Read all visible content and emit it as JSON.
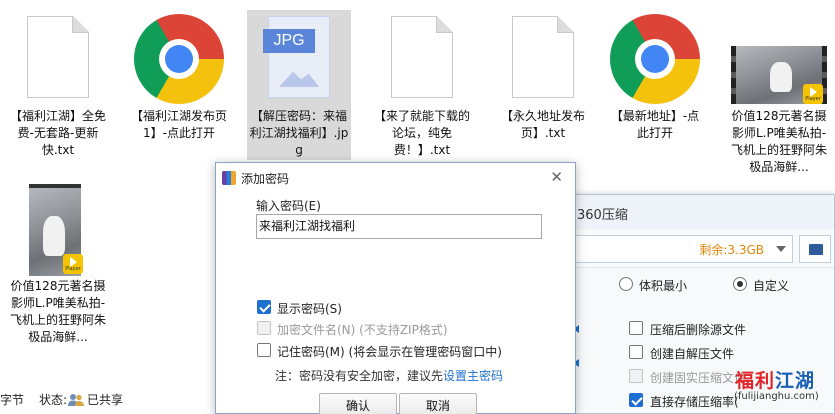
{
  "explorer": {
    "files": [
      {
        "name": "【福利江湖】全免费-无套路-更新快.txt",
        "kind": "txt"
      },
      {
        "name": "【福利江湖发布页1】-点此打开",
        "kind": "chrome"
      },
      {
        "name": "【解压密码：来福利江湖找福利】.jpg",
        "kind": "jpg",
        "icon_text": "JPG"
      },
      {
        "name": "【来了就能下载的论坛，纯免费！】.txt",
        "kind": "txt"
      },
      {
        "name": "【永久地址发布页】.txt",
        "kind": "txt"
      },
      {
        "name": "【最新地址】-点此打开",
        "kind": "chrome"
      },
      {
        "name": "价值128元著名摄影师L.P唯美私拍-飞机上的狂野阿朱 极品海鲜...",
        "kind": "video",
        "badge": "Player"
      },
      {
        "name": "价值128元著名摄影师L.P唯美私拍-飞机上的狂野阿朱 极品海鲜...",
        "kind": "video",
        "badge": "Player"
      }
    ],
    "status": {
      "left": "字节",
      "state_label": "状态:",
      "share_text": "已共享"
    }
  },
  "compressor": {
    "title": "360压缩",
    "remaining": "剩余:3.3GB",
    "radio_options": [
      {
        "label": "体积最小",
        "selected": false
      },
      {
        "label": "自定义",
        "selected": true
      }
    ],
    "checkboxes": [
      {
        "label": "压缩后删除源文件",
        "checked": false,
        "disabled": false
      },
      {
        "label": "创建自解压文件",
        "checked": false,
        "disabled": false
      },
      {
        "label": "创建固实压缩文件",
        "checked": false,
        "disabled": true
      },
      {
        "label": "直接存储压缩率(",
        "checked": true,
        "disabled": false
      }
    ]
  },
  "dialog": {
    "title": "添加密码",
    "close": "✕",
    "input_label": "输入密码(E)",
    "password_value": "来福利江湖找福利",
    "options": [
      {
        "label": "显示密码(S)",
        "checked": true,
        "disabled": false
      },
      {
        "label": "加密文件名(N)  (不支持ZIP格式)",
        "checked": false,
        "disabled": true
      },
      {
        "label": "记住密码(M)  (将会显示在管理密码窗口中)",
        "checked": false,
        "disabled": false
      }
    ],
    "hint_prefix": "注：密码没有安全加密，建议先",
    "hint_link": "设置主密码",
    "ok_label": "确认",
    "cancel_label": "取消"
  },
  "watermark": {
    "part1": "福利",
    "part2": "江湖",
    "url": "(fulijianghu.com)"
  },
  "colors": {
    "accent": "#1f6fd1",
    "remaining": "#e0870b",
    "watermark_red": "#e0262a",
    "watermark_blue": "#1a5fb4"
  }
}
